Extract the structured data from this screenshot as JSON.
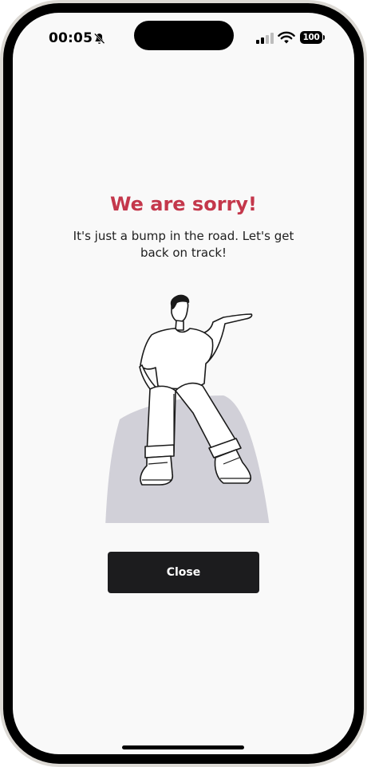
{
  "status_bar": {
    "time": "00:05",
    "battery_level": "100",
    "icons": [
      "bell-off-icon",
      "signal-icon",
      "wifi-icon",
      "battery-icon"
    ]
  },
  "error_screen": {
    "title": "We are sorry!",
    "message": "It's just a bump in the road. Let's get back on track!",
    "close_label": "Close"
  },
  "colors": {
    "title": "#c4374b",
    "button_background": "#1c1c1e",
    "screen_background": "#f9f9f9",
    "illustration_shadow": "#d1d0d8"
  }
}
